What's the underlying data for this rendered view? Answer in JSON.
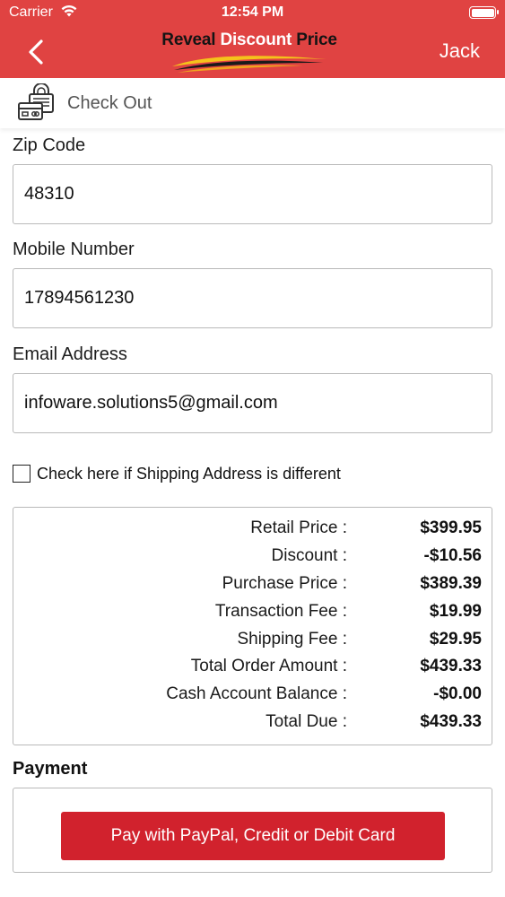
{
  "status_bar": {
    "carrier": "Carrier",
    "time": "12:54 PM"
  },
  "navbar": {
    "logo_text_main": "Reveal ",
    "logo_text_accent": "Discount",
    "logo_text_end": " Price",
    "user_name": "Jack"
  },
  "section": {
    "title": "Check Out"
  },
  "form": {
    "zip": {
      "label": "Zip Code",
      "value": "48310"
    },
    "mobile": {
      "label": "Mobile Number",
      "value": "17894561230"
    },
    "email": {
      "label": "Email Address",
      "value": "infoware.solutions5@gmail.com"
    },
    "shipping_checkbox": {
      "label": "Check here if Shipping Address is different",
      "checked": false
    }
  },
  "summary": {
    "rows": [
      {
        "label": "Retail Price :",
        "value": "$399.95"
      },
      {
        "label": "Discount :",
        "value": "-$10.56"
      },
      {
        "label": "Purchase Price :",
        "value": "$389.39"
      },
      {
        "label": "Transaction Fee :",
        "value": "$19.99"
      },
      {
        "label": "Shipping Fee :",
        "value": "$29.95"
      },
      {
        "label": "Total Order Amount :",
        "value": "$439.33"
      },
      {
        "label": "Cash Account Balance :",
        "value": "-$0.00"
      },
      {
        "label": "Total Due :",
        "value": "$439.33"
      }
    ]
  },
  "payment": {
    "title": "Payment",
    "button_label": "Pay with PayPal, Credit or Debit Card"
  },
  "colors": {
    "header": "#e04342",
    "pay_button": "#d1222d"
  }
}
